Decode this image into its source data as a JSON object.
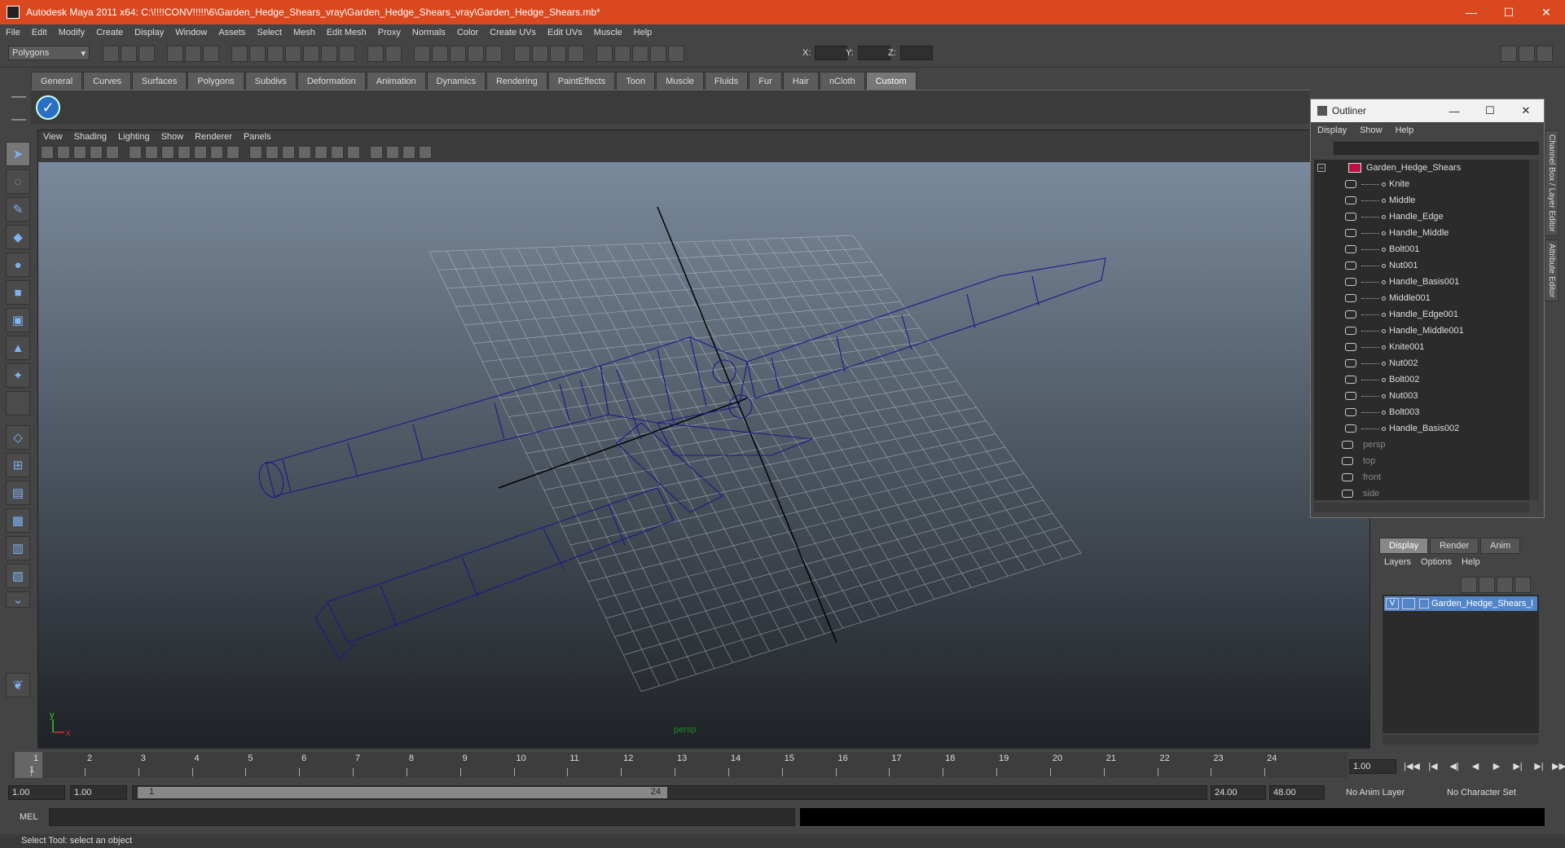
{
  "window": {
    "title": "Autodesk Maya 2011 x64: C:\\!!!!CONV!!!!!\\6\\Garden_Hedge_Shears_vray\\Garden_Hedge_Shears_vray\\Garden_Hedge_Shears.mb*",
    "minimize": "—",
    "maximize": "☐",
    "close": "✕"
  },
  "menubar": [
    "File",
    "Edit",
    "Modify",
    "Create",
    "Display",
    "Window",
    "Assets",
    "Select",
    "Mesh",
    "Edit Mesh",
    "Proxy",
    "Normals",
    "Color",
    "Create UVs",
    "Edit UVs",
    "Muscle",
    "Help"
  ],
  "statusline": {
    "mode": "Polygons",
    "x_label": "X:",
    "y_label": "Y:",
    "z_label": "Z:"
  },
  "shelf_tabs": [
    "General",
    "Curves",
    "Surfaces",
    "Polygons",
    "Subdivs",
    "Deformation",
    "Animation",
    "Dynamics",
    "Rendering",
    "PaintEffects",
    "Toon",
    "Muscle",
    "Fluids",
    "Fur",
    "Hair",
    "nCloth",
    "Custom"
  ],
  "shelf_active": "Custom",
  "panel_menu": [
    "View",
    "Shading",
    "Lighting",
    "Show",
    "Renderer",
    "Panels"
  ],
  "viewport": {
    "camera_label": "persp",
    "axis_x": "x",
    "axis_y": "y"
  },
  "outliner": {
    "title": "Outliner",
    "menu": [
      "Display",
      "Show",
      "Help"
    ],
    "root": "Garden_Hedge_Shears",
    "children": [
      "Knite",
      "Middle",
      "Handle_Edge",
      "Handle_Middle",
      "Bolt001",
      "Nut001",
      "Handle_Basis001",
      "Middle001",
      "Handle_Edge001",
      "Handle_Middle001",
      "Knite001",
      "Nut002",
      "Bolt002",
      "Nut003",
      "Bolt003",
      "Handle_Basis002"
    ],
    "cameras": [
      "persp",
      "top",
      "front",
      "side"
    ]
  },
  "side_tabs": [
    "Channel Box / Layer Editor",
    "Attribute Editor"
  ],
  "layer_editor": {
    "tabs": [
      "Display",
      "Render",
      "Anim"
    ],
    "active_tab": "Display",
    "menu": [
      "Layers",
      "Options",
      "Help"
    ],
    "layers": [
      {
        "visible": "V",
        "name": "Garden_Hedge_Shears_l"
      }
    ]
  },
  "timeline": {
    "ticks": [
      "1",
      "2",
      "3",
      "4",
      "5",
      "6",
      "7",
      "8",
      "9",
      "10",
      "11",
      "12",
      "13",
      "14",
      "15",
      "16",
      "17",
      "18",
      "19",
      "20",
      "21",
      "22",
      "23",
      "24"
    ],
    "current_marker": "1",
    "current_frame": "1.00",
    "play_buttons": [
      "|◀◀",
      "|◀",
      "◀|",
      "◀",
      "▶",
      "▶|",
      "▶|",
      "▶▶|"
    ]
  },
  "range": {
    "start_time": "1.00",
    "playback_start": "1.00",
    "range_min_label": "1",
    "range_max_label": "24",
    "playback_end": "24.00",
    "end_time": "48.00",
    "anim_layer": "No Anim Layer",
    "character_set": "No Character Set"
  },
  "command": {
    "label": "MEL"
  },
  "helpline": "Select Tool: select an object"
}
